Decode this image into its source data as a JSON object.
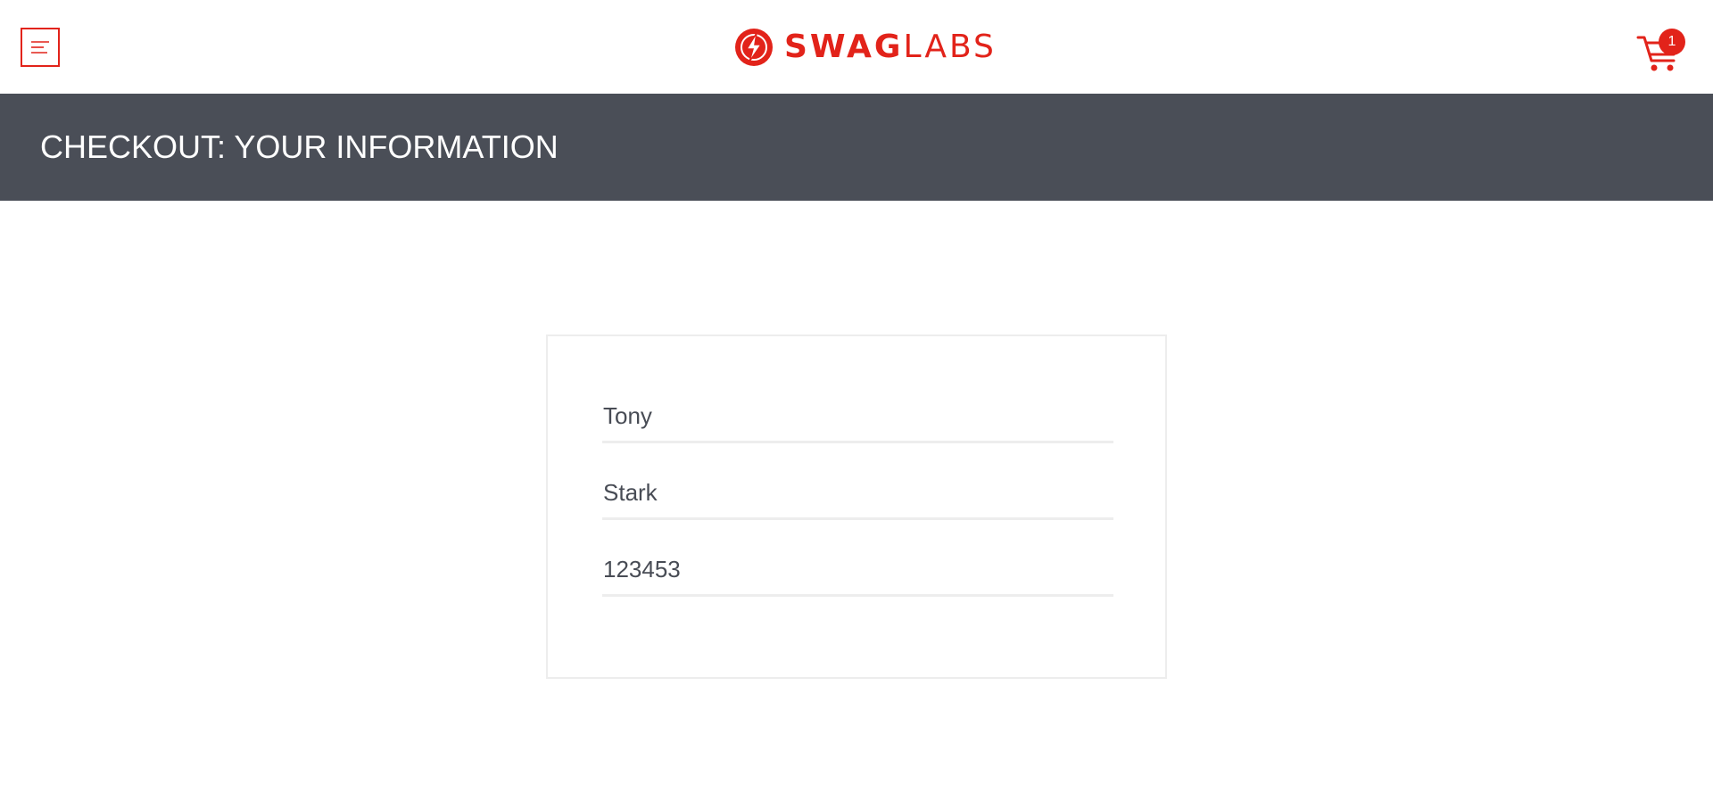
{
  "header": {
    "menu_icon": "hamburger-menu-icon",
    "logo": {
      "text_bold": "SWAG",
      "text_light": "LABS",
      "icon": "lightning-circle-icon"
    },
    "cart": {
      "icon": "shopping-cart-icon",
      "badge_count": "1"
    }
  },
  "title_bar": {
    "title": "CHECKOUT: YOUR INFORMATION"
  },
  "form": {
    "first_name": "Tony",
    "last_name": "Stark",
    "postal_code": "123453"
  },
  "colors": {
    "brand_red": "#e2231a",
    "title_bar_bg": "#4a4e57",
    "input_text": "#484c55",
    "border_light": "#ededed"
  }
}
